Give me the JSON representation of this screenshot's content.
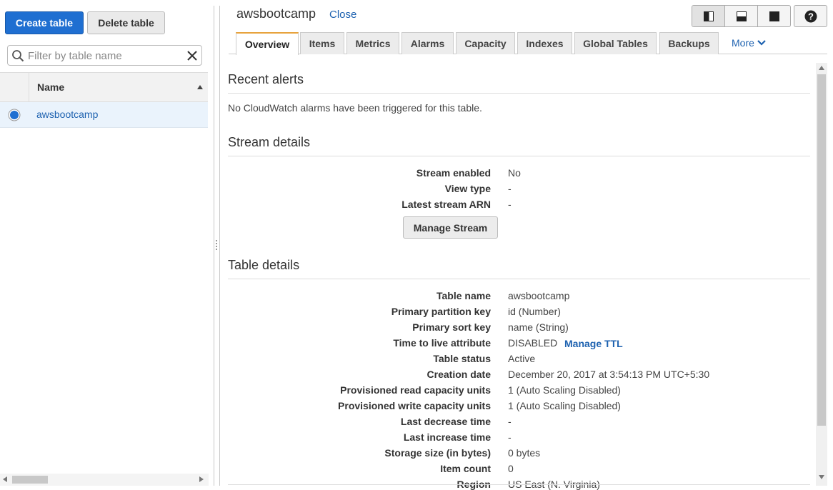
{
  "left": {
    "create_button": "Create table",
    "delete_button": "Delete table",
    "filter_placeholder": "Filter by table name",
    "column_header": "Name",
    "tables": [
      "awsbootcamp"
    ]
  },
  "header": {
    "title": "awsbootcamp",
    "close_link": "Close"
  },
  "tabs": [
    "Overview",
    "Items",
    "Metrics",
    "Alarms",
    "Capacity",
    "Indexes",
    "Global Tables",
    "Backups"
  ],
  "more_tab": "More",
  "recent_alerts": {
    "title": "Recent alerts",
    "message": "No CloudWatch alarms have been triggered for this table."
  },
  "stream_details": {
    "title": "Stream details",
    "rows": [
      {
        "label": "Stream enabled",
        "value": "No"
      },
      {
        "label": "View type",
        "value": "-"
      },
      {
        "label": "Latest stream ARN",
        "value": "-"
      }
    ],
    "manage_button": "Manage Stream"
  },
  "table_details": {
    "title": "Table details",
    "rows": [
      {
        "label": "Table name",
        "value": "awsbootcamp"
      },
      {
        "label": "Primary partition key",
        "value": "id (Number)"
      },
      {
        "label": "Primary sort key",
        "value": "name (String)"
      },
      {
        "label": "Time to live attribute",
        "value": "DISABLED"
      },
      {
        "label": "Table status",
        "value": "Active"
      },
      {
        "label": "Creation date",
        "value": "December 20, 2017 at 3:54:13 PM UTC+5:30"
      },
      {
        "label": "Provisioned read capacity units",
        "value": "1 (Auto Scaling Disabled)"
      },
      {
        "label": "Provisioned write capacity units",
        "value": "1 (Auto Scaling Disabled)"
      },
      {
        "label": "Last decrease time",
        "value": "-"
      },
      {
        "label": "Last increase time",
        "value": "-"
      },
      {
        "label": "Storage size (in bytes)",
        "value": "0 bytes"
      },
      {
        "label": "Item count",
        "value": "0"
      },
      {
        "label": "Region",
        "value": "US East (N. Virginia)"
      }
    ],
    "manage_ttl": "Manage TTL"
  },
  "colors": {
    "primary": "#1f6fd1",
    "link": "#1e62b0",
    "tab_accent": "#e7a33e",
    "selected_row": "#eaf3fc"
  },
  "icons": {
    "filter": "search-icon",
    "clear": "close-icon",
    "sort": "sort-ascending-icon",
    "selection": "radio-selected-icon",
    "layout_split_vertical": "layout-split-vertical-icon",
    "layout_split_horizontal": "layout-split-horizontal-icon",
    "layout_full": "layout-full-icon",
    "help": "help-icon",
    "more": "chevron-down-icon"
  }
}
